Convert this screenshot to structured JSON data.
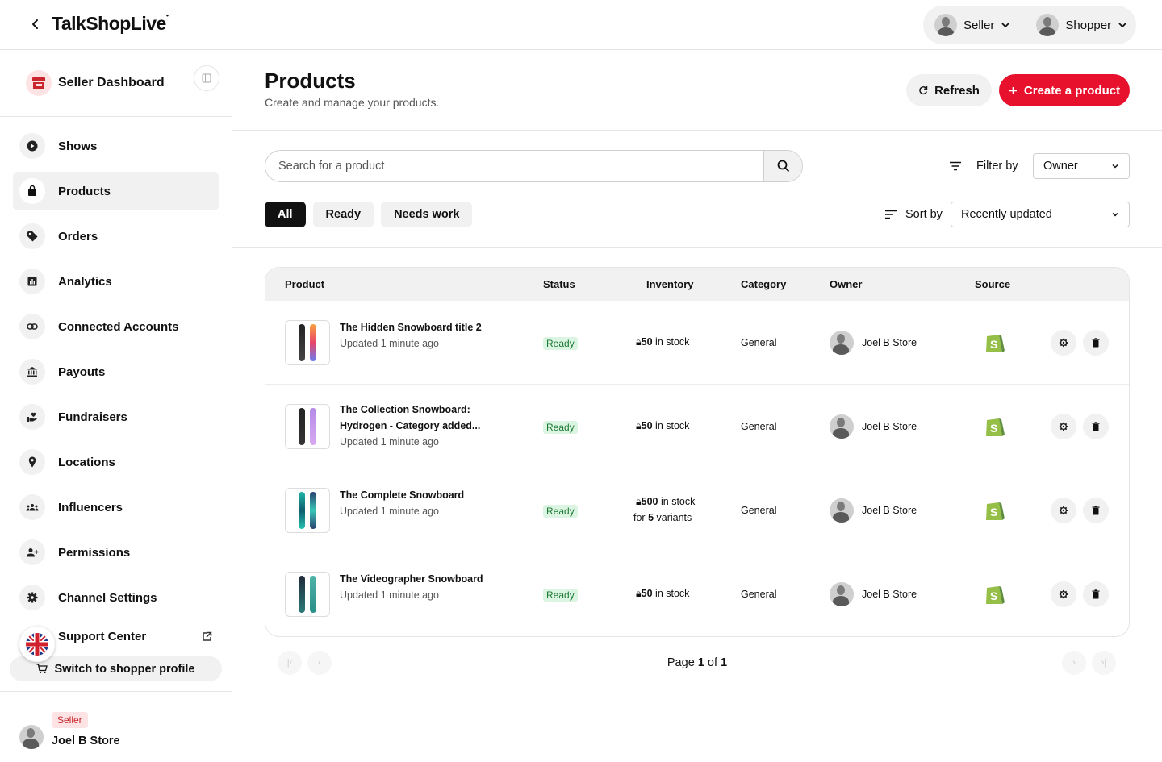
{
  "app": {
    "title": "TalkShopLive",
    "title_mark": "•"
  },
  "role_switch": {
    "seller_label": "Seller",
    "shopper_label": "Shopper"
  },
  "sidebar": {
    "title": "Seller Dashboard",
    "items": [
      {
        "label": "Shows",
        "icon": "play-icon"
      },
      {
        "label": "Products",
        "icon": "shopping-bag-icon",
        "active": true
      },
      {
        "label": "Orders",
        "icon": "tag-icon"
      },
      {
        "label": "Analytics",
        "icon": "bar-chart-icon"
      },
      {
        "label": "Connected Accounts",
        "icon": "link-icon"
      },
      {
        "label": "Payouts",
        "icon": "bank-icon"
      },
      {
        "label": "Fundraisers",
        "icon": "heart-hand-icon"
      },
      {
        "label": "Locations",
        "icon": "map-pin-icon"
      },
      {
        "label": "Influencers",
        "icon": "group-icon"
      },
      {
        "label": "Permissions",
        "icon": "add-user-icon"
      },
      {
        "label": "Channel Settings",
        "icon": "gear-icon"
      },
      {
        "label": "Support Center",
        "icon": "external-link-icon"
      }
    ],
    "switch_label": "Switch to shopper profile",
    "user": {
      "badge": "Seller",
      "name": "Joel B Store"
    }
  },
  "header": {
    "title": "Products",
    "subtitle": "Create and manage your products.",
    "refresh_label": "Refresh",
    "create_label": "Create a product"
  },
  "search": {
    "placeholder": "Search for a product"
  },
  "filter": {
    "label": "Filter by",
    "value": "Owner"
  },
  "sort": {
    "label": "Sort by",
    "value": "Recently updated"
  },
  "tabs": [
    "All",
    "Ready",
    "Needs work"
  ],
  "table": {
    "columns": [
      "Product",
      "Status",
      "Inventory",
      "Category",
      "Owner",
      "Source"
    ],
    "rows": [
      {
        "name": "The Hidden Snowboard title 2",
        "name2": "",
        "updated": "Updated 1 minute ago",
        "status": "Ready",
        "stock": "50",
        "stock_suffix": " in stock",
        "variants_line": "",
        "category": "General",
        "owner": "Joel B Store"
      },
      {
        "name": "The Collection Snowboard:",
        "name2": "Hydrogen - Category added...",
        "updated": "Updated 1 minute ago",
        "status": "Ready",
        "stock": "50",
        "stock_suffix": " in stock",
        "variants_line": "",
        "category": "General",
        "owner": "Joel B Store"
      },
      {
        "name": "The Complete Snowboard",
        "name2": "",
        "updated": "Updated 1 minute ago",
        "status": "Ready",
        "stock": "500",
        "stock_suffix": " in stock",
        "variants_pre": "for ",
        "variants_num": "5",
        "variants_post": " variants",
        "category": "General",
        "owner": "Joel B Store"
      },
      {
        "name": "The Videographer Snowboard",
        "name2": "",
        "updated": "Updated 1 minute ago",
        "status": "Ready",
        "stock": "50",
        "stock_suffix": " in stock",
        "variants_line": "",
        "category": "General",
        "owner": "Joel B Store"
      }
    ]
  },
  "pagination": {
    "prefix": "Page ",
    "current": "1",
    "of": " of ",
    "total": "1"
  },
  "colors": {
    "accent": "#e8112d",
    "ready_bg": "#dcf5e2",
    "ready_text": "#1d7a35",
    "shopify": "#95bf47"
  }
}
